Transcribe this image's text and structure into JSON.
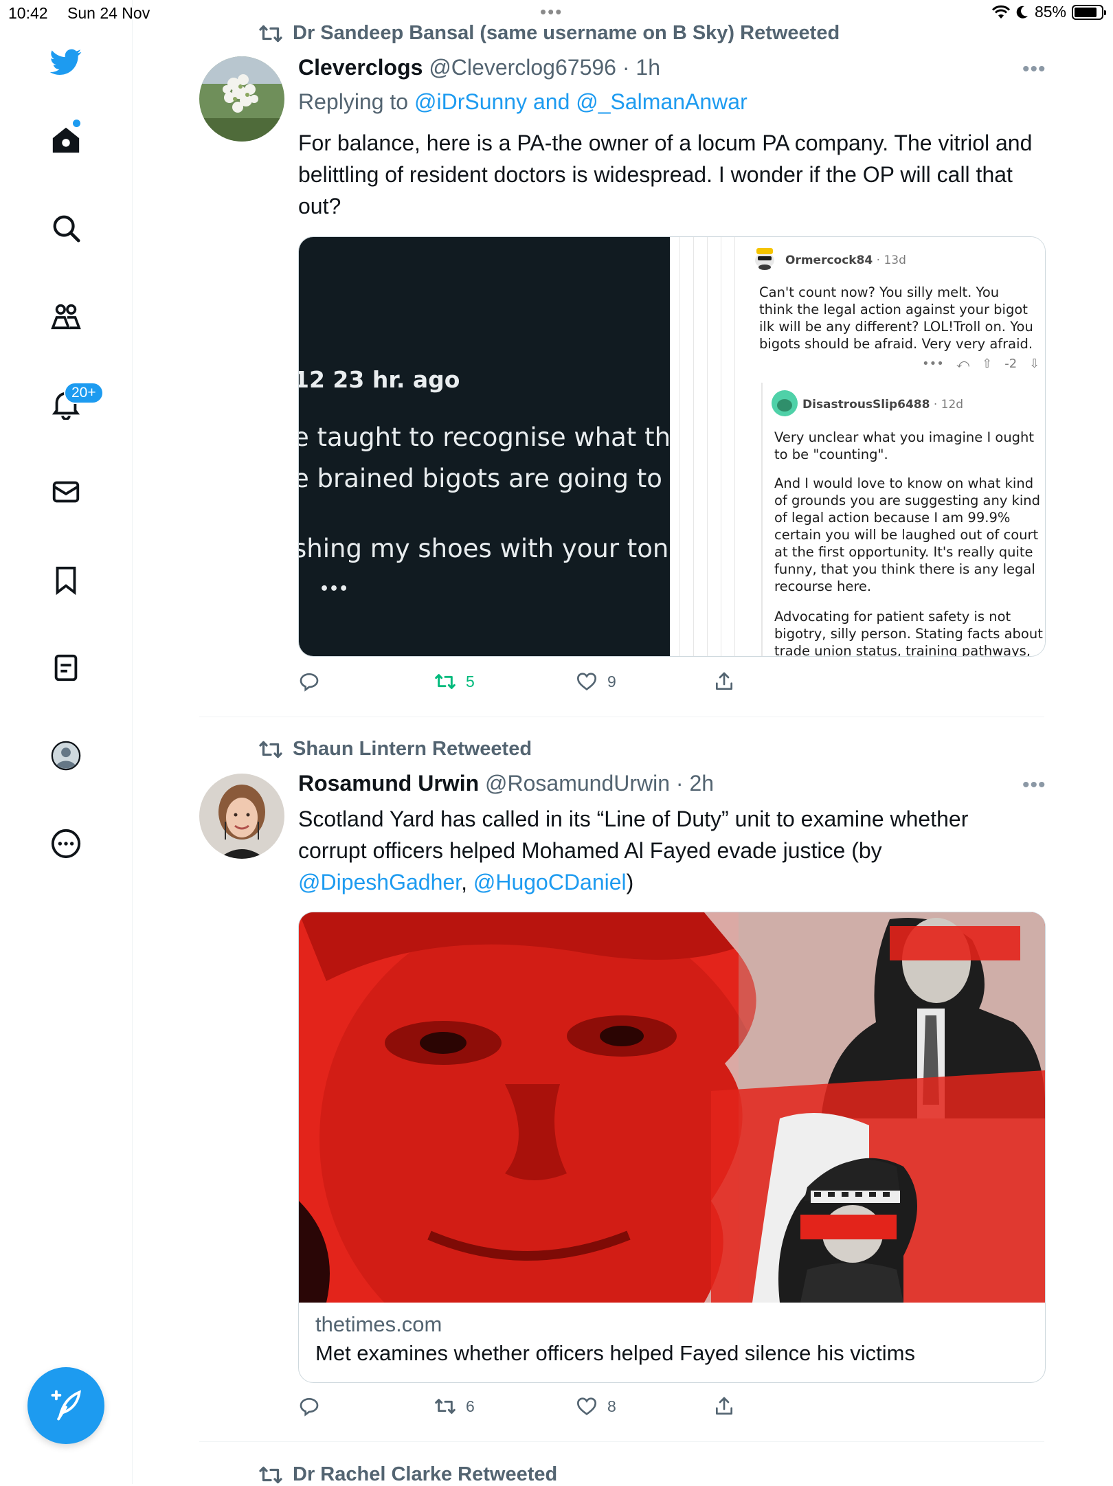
{
  "status_bar": {
    "time": "10:42",
    "date": "Sun 24 Nov",
    "battery": "85%",
    "battery_level": 0.85
  },
  "sidebar": {
    "notification_badge": "20+"
  },
  "tweets": [
    {
      "retweeted_by": "Dr Sandeep Bansal (same username on B Sky) Retweeted",
      "name": "Cleverclogs",
      "handle": "@Cleverclog67596 · 1h",
      "reply_prefix": "Replying to ",
      "reply_to": "@iDrSunny and @_SalmanAnwar",
      "text": "For balance, here is a PA-the owner of a locum PA company. The vitriol and belittling of resident doctors is widespread. I wonder if the OP will call that out?",
      "screenshot": {
        "dark_header": "12 23 hr. ago",
        "dark_lines": [
          "e taught to recognise what they",
          "e brained bigots are going to pa",
          "shing my shoes with your tongu"
        ],
        "dark_more": "•••",
        "comment1_user": "Ormercock84",
        "comment1_age": "· 13d",
        "comment1_text": "Can't count now? You silly melt. You think the legal action against your bigot ilk will be any different? LOL!Troll on. You bigots should be afraid. Very very afraid.",
        "comment1_score": "-2",
        "comment2_user": "DisastrousSlip6488",
        "comment2_age": "· 12d",
        "comment2_p1": "Very unclear what you imagine I ought to be \"counting\".",
        "comment2_p2": "And I would love to know on what kind of grounds you are suggesting any kind of legal action because I am 99.9% certain you will be laughed out of court at the first opportunity.  It's really quite funny, that you think there is any legal recourse here.",
        "comment2_p3": "Advocating for patient safety is not bigotry, silly person. Stating facts about trade union status, training pathways,"
      },
      "retweets": "5",
      "likes": "9"
    },
    {
      "retweeted_by": "Shaun Lintern Retweeted",
      "name": "Rosamund Urwin",
      "handle": "@RosamundUrwin · 2h",
      "text_before": "Scotland Yard has called in its “Line of Duty” unit to examine whether corrupt officers helped Mohamed Al Fayed evade justice (by ",
      "mention1": "@DipeshGadher",
      "text_between": ", ",
      "mention2": "@HugoCDaniel",
      "text_after": ")",
      "link_domain": "thetimes.com",
      "link_title": "Met examines whether officers helped Fayed silence his victims",
      "retweets": "6",
      "likes": "8"
    },
    {
      "retweeted_by": "Dr Rachel Clarke Retweeted"
    }
  ],
  "colors": {
    "accent": "#1d9bf0",
    "secondary_text": "#536471",
    "retweet_active": "#00ba7c"
  },
  "icons": [
    "twitter-logo-icon",
    "home-icon",
    "search-icon",
    "communities-icon",
    "notifications-icon",
    "messages-icon",
    "bookmarks-icon",
    "lists-icon",
    "profile-icon",
    "more-icon",
    "retweet-icon",
    "reply-icon",
    "like-icon",
    "share-icon",
    "compose-icon"
  ]
}
